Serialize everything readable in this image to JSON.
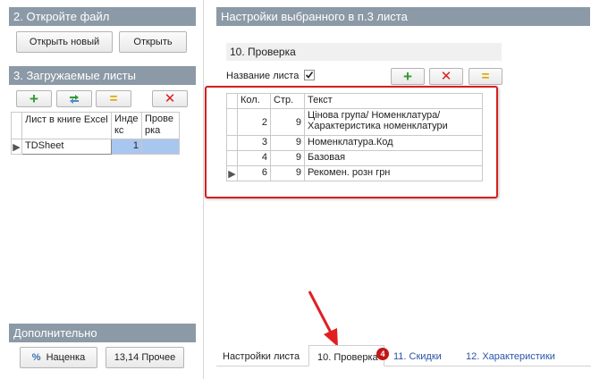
{
  "left": {
    "open_file": {
      "header": "2. Откройте файл",
      "open_new_label": "Открыть новый",
      "open_label": "Открыть"
    },
    "sheets": {
      "header": "3. Загружаемые листы",
      "columns": [
        "Лист в книге Excel",
        "Индекс",
        "Проверка"
      ],
      "col_index_lines": [
        "Инде",
        "кс"
      ],
      "col_check_lines": [
        "Прове",
        "рка"
      ],
      "rows": [
        {
          "name": "TDSheet",
          "index": "1",
          "check": ""
        }
      ]
    },
    "extra": {
      "header": "Дополнительно",
      "markup_label": "Наценка",
      "other_label": "13,14 Прочее"
    }
  },
  "right": {
    "header": "Настройки выбранного в п.3 листа",
    "subheader": "10. Проверка",
    "sheet_name_label": "Название листа",
    "sheet_name_checked": true,
    "table": {
      "columns": [
        "Кол.",
        "Стр.",
        "Текст"
      ],
      "rows": [
        {
          "col": "2",
          "row": "9",
          "text": "Цінова група/ Номенклатура/ Характеристика номенклатури"
        },
        {
          "col": "3",
          "row": "9",
          "text": "Номенклатура.Код"
        },
        {
          "col": "4",
          "row": "9",
          "text": "Базовая"
        },
        {
          "col": "6",
          "row": "9",
          "text": "Рекомен. розн грн"
        }
      ]
    }
  },
  "tabs": [
    {
      "label": "Настройки листа"
    },
    {
      "label": "10. Проверка",
      "badge": "4"
    },
    {
      "label": "11. Скидки"
    },
    {
      "label": "12. Характеристики"
    }
  ],
  "colors": {
    "header_bg": "#8b9aa6",
    "highlight_border": "#d42020",
    "annotation_arrow": "#e02020",
    "link": "#2a55a6",
    "selected_cell": "#a9c6ef"
  }
}
